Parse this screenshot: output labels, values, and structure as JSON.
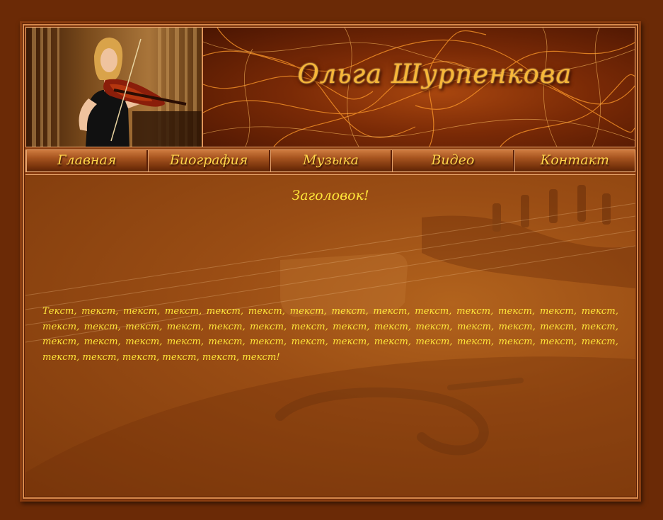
{
  "site": {
    "title": "Ольга Шурпенкова"
  },
  "nav": {
    "items": [
      {
        "label": "Главная"
      },
      {
        "label": "Биография"
      },
      {
        "label": "Музыка"
      },
      {
        "label": "Видео"
      },
      {
        "label": "Контакт"
      }
    ]
  },
  "main": {
    "heading": "Заголовок!",
    "body": "Текст, текст, текст, текст, текст, текст, текст, текст, текст, текст, текст, текст, текст, текст, текст, текст, текст, текст, текст, текст, текст, текст, текст, текст, текст, текст, текст, текст, текст, текст, текст, текст, текст, текст, текст, текст, текст, текст, текст, текст, текст, текст, текст, текст, текст, текст, текст, текст!"
  },
  "colors": {
    "page_background": "#6b2a06",
    "frame": "#8a3d10",
    "title_gold": "#f7b738",
    "nav_text": "#ffd54a",
    "content_text": "#ffe63a"
  }
}
